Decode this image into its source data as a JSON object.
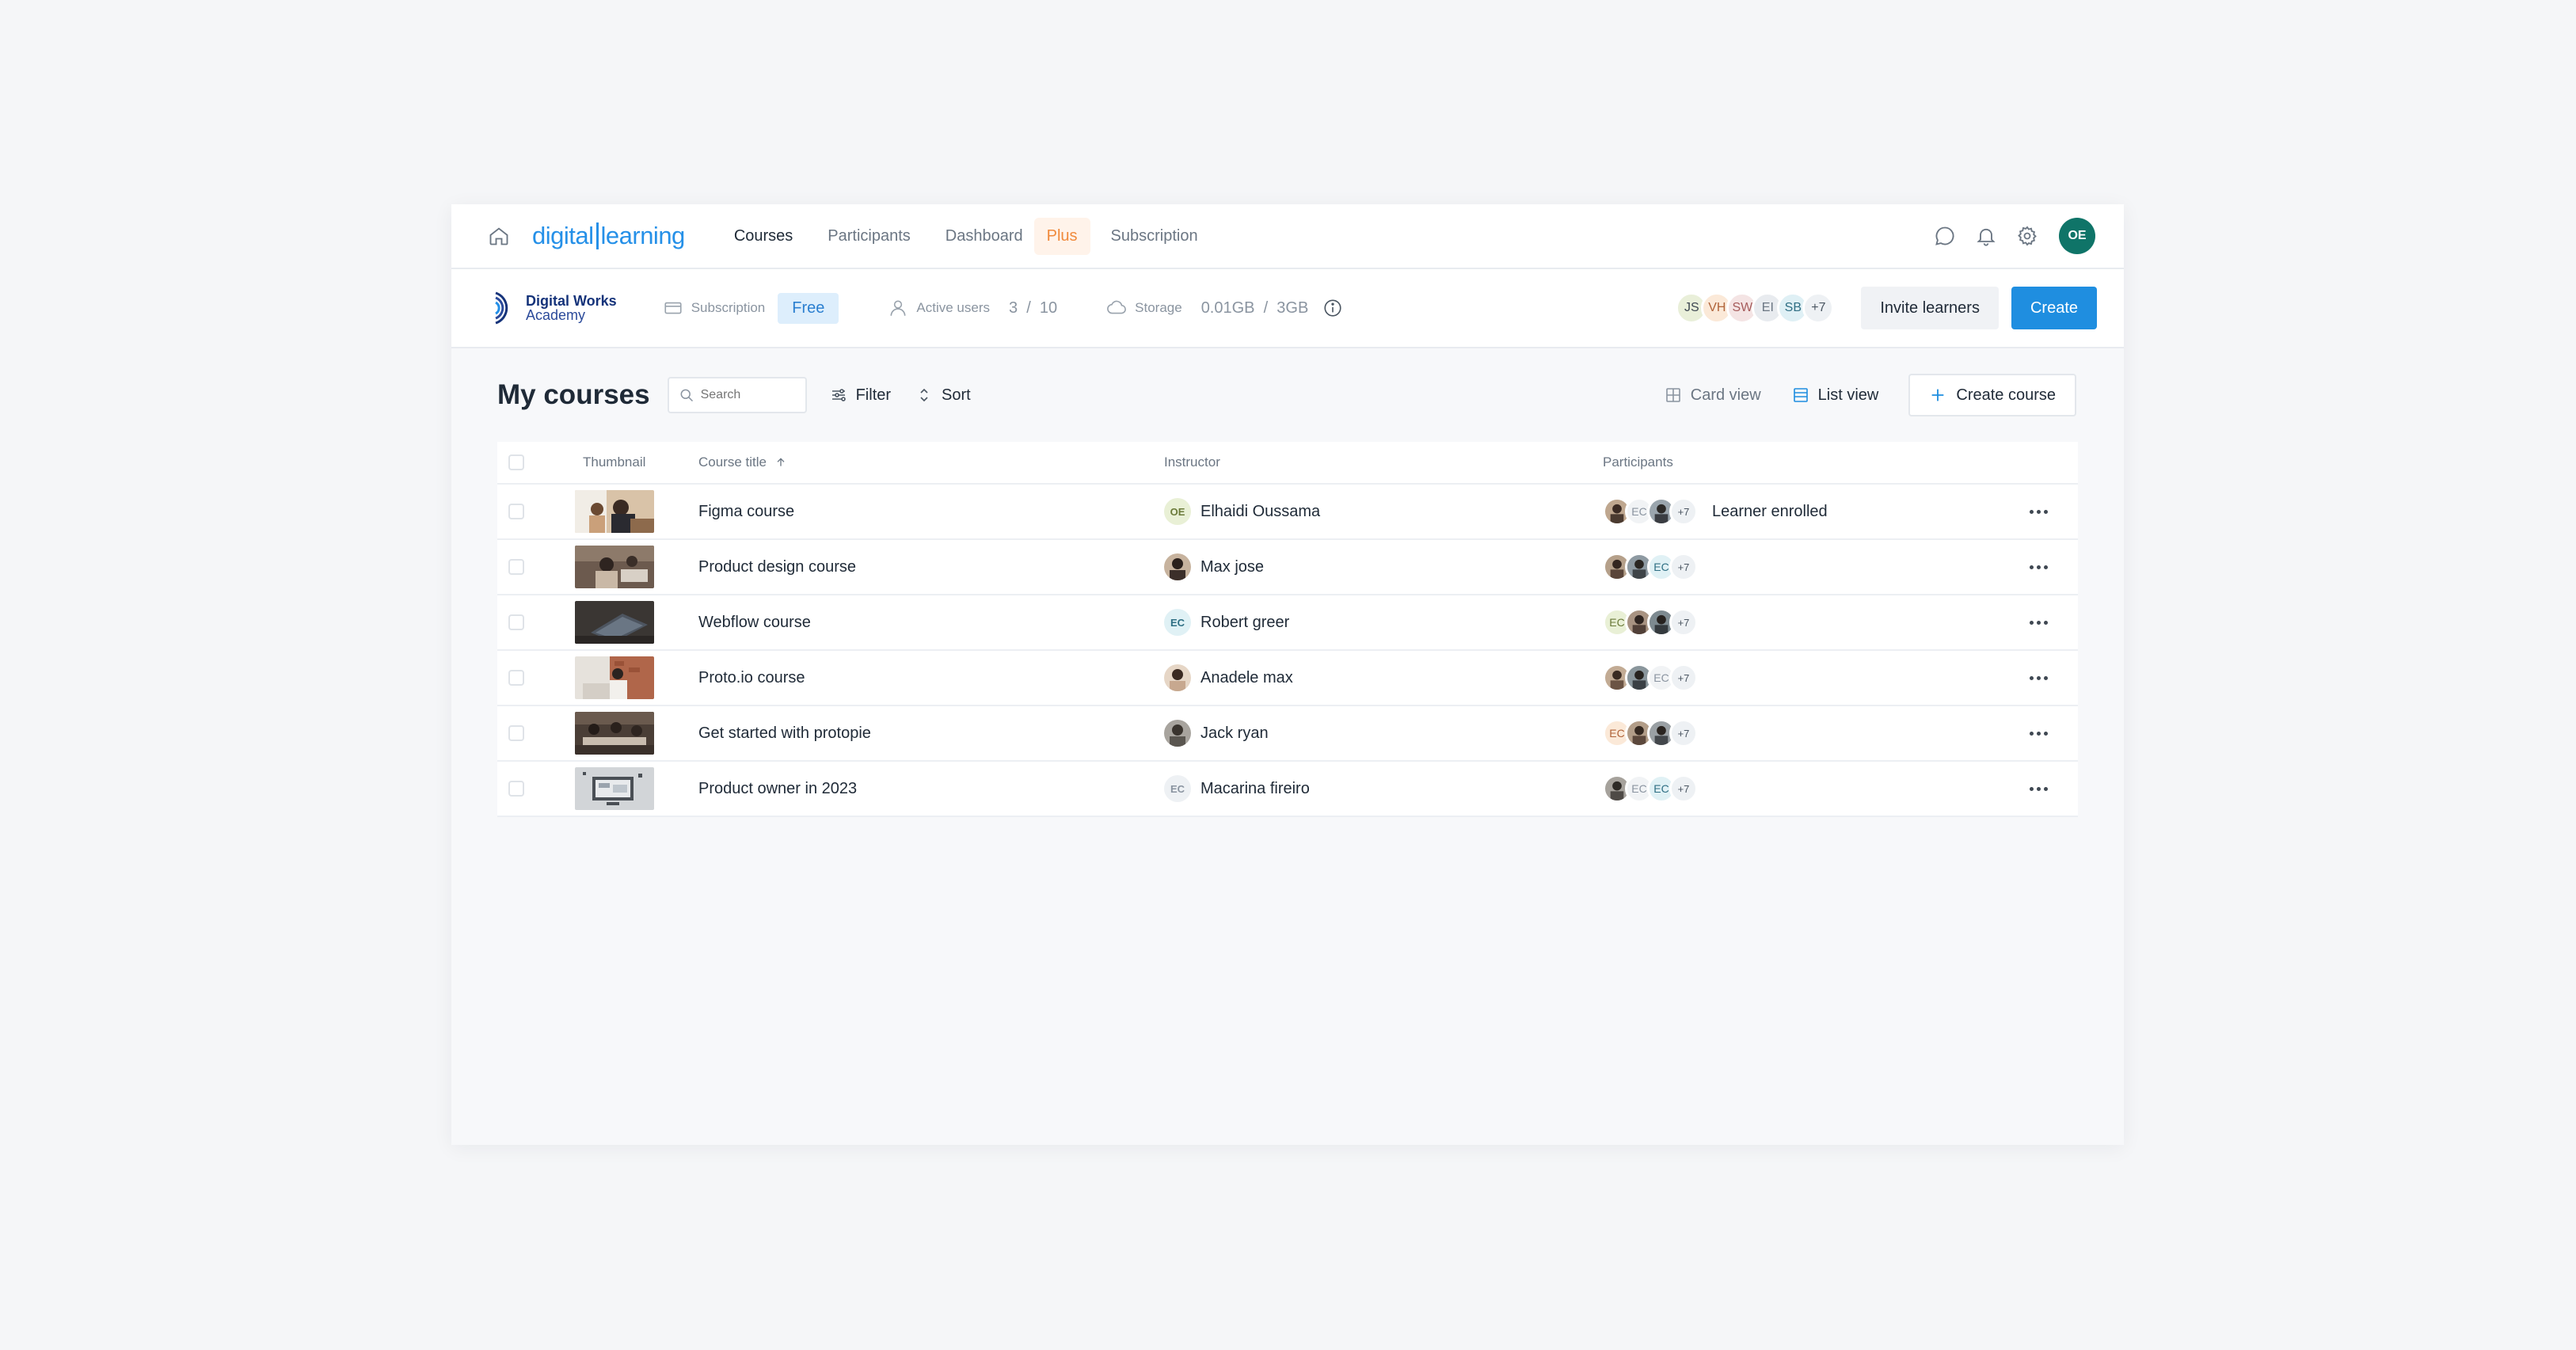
{
  "nav": {
    "logo_part1": "digital",
    "logo_part2": "learning",
    "tabs": [
      {
        "label": "Courses"
      },
      {
        "label": "Participants"
      },
      {
        "label": "Dashboard"
      },
      {
        "label": "Plus"
      },
      {
        "label": "Subscription"
      }
    ],
    "user_initials": "OE",
    "colors": {
      "brand": "#2590e8",
      "plus": "#f08a3c",
      "user_avatar": "#0f7468"
    }
  },
  "subbar": {
    "academy_line1": "Digital Works",
    "academy_line2": "Academy",
    "subscription_label": "Subscription",
    "subscription_plan": "Free",
    "active_users_label": "Active users",
    "active_users_value": "3  /  10",
    "storage_label": "Storage",
    "storage_value": "0.01GB  /  3GB",
    "avatars": [
      {
        "initials": "JS",
        "bg": "#e9efd9"
      },
      {
        "initials": "VH",
        "bg": "#fbe9d8"
      },
      {
        "initials": "SW",
        "bg": "#f4e4e4"
      },
      {
        "initials": "EI",
        "bg": "#e8ebef"
      },
      {
        "initials": "SB",
        "bg": "#dff0f5"
      },
      {
        "initials": "+7",
        "bg": "#eef1f4"
      }
    ],
    "invite_label": "Invite learners",
    "create_label": "Create"
  },
  "toolbar": {
    "title": "My courses",
    "search_placeholder": "Search",
    "filter_label": "Filter",
    "sort_label": "Sort",
    "card_view_label": "Card view",
    "list_view_label": "List view",
    "create_course_label": "Create course"
  },
  "table": {
    "headers": {
      "thumbnail": "Thumbnail",
      "title": "Course title",
      "instructor": "Instructor",
      "participants": "Participants"
    },
    "rows": [
      {
        "title": "Figma course",
        "instructor": "Elhaidi Oussama",
        "instructor_initials": "OE",
        "more": "+7",
        "note": "Learner enrolled"
      },
      {
        "title": "Product design course",
        "instructor": "Max jose",
        "instructor_initials": "",
        "more": "+7",
        "note": ""
      },
      {
        "title": "Webflow course",
        "instructor": "Robert greer",
        "instructor_initials": "EC",
        "more": "+7",
        "note": ""
      },
      {
        "title": "Proto.io course",
        "instructor": "Anadele max",
        "instructor_initials": "",
        "more": "+7",
        "note": ""
      },
      {
        "title": "Get started with protopie",
        "instructor": "Jack ryan",
        "instructor_initials": "",
        "more": "+7",
        "note": ""
      },
      {
        "title": "Product owner in 2023",
        "instructor": "Macarina fireiro",
        "instructor_initials": "EC",
        "more": "+7",
        "note": ""
      }
    ],
    "participant_initials": "EC"
  }
}
